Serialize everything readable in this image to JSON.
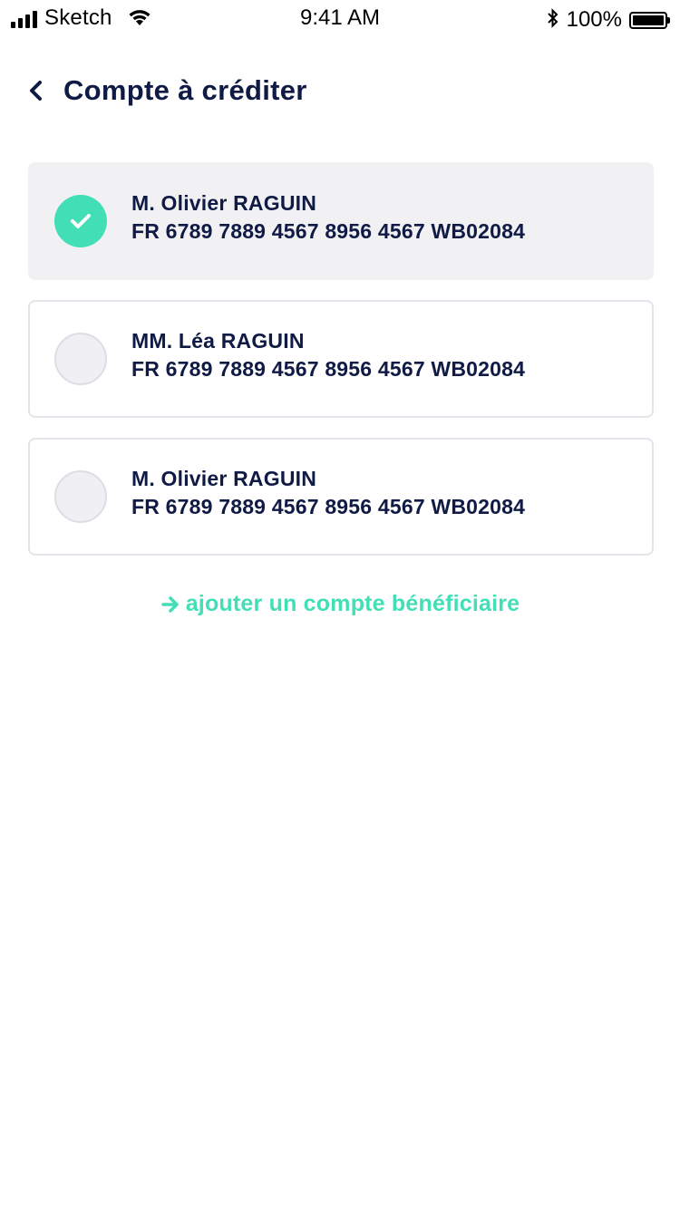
{
  "status_bar": {
    "carrier": "Sketch",
    "time": "9:41 AM",
    "battery": "100%",
    "battery_level": 1.0,
    "icons": [
      "signal-icon",
      "wifi-icon",
      "bluetooth-icon",
      "battery-icon"
    ]
  },
  "header": {
    "back_icon": "chevron-left-icon",
    "title": "Compte à créditer"
  },
  "accounts": [
    {
      "name": "M. Olivier RAGUIN",
      "iban": "FR 6789 7889 4567 8956 4567 WB02084",
      "selected": true
    },
    {
      "name": "MM. Léa RAGUIN",
      "iban": "FR 6789 7889 4567 8956 4567 WB02084",
      "selected": false
    },
    {
      "name": "M. Olivier RAGUIN",
      "iban": "FR 6789 7889 4567 8956 4567 WB02084",
      "selected": false
    }
  ],
  "add_link": {
    "icon": "arrow-right-icon",
    "label": "ajouter un compte bénéficiaire"
  },
  "colors": {
    "text": "#0f1a45",
    "accent": "#42dfb6",
    "selected_card_bg": "#f1f1f4",
    "card_border": "#e4e4ea",
    "radio_bg": "#efeff4"
  }
}
